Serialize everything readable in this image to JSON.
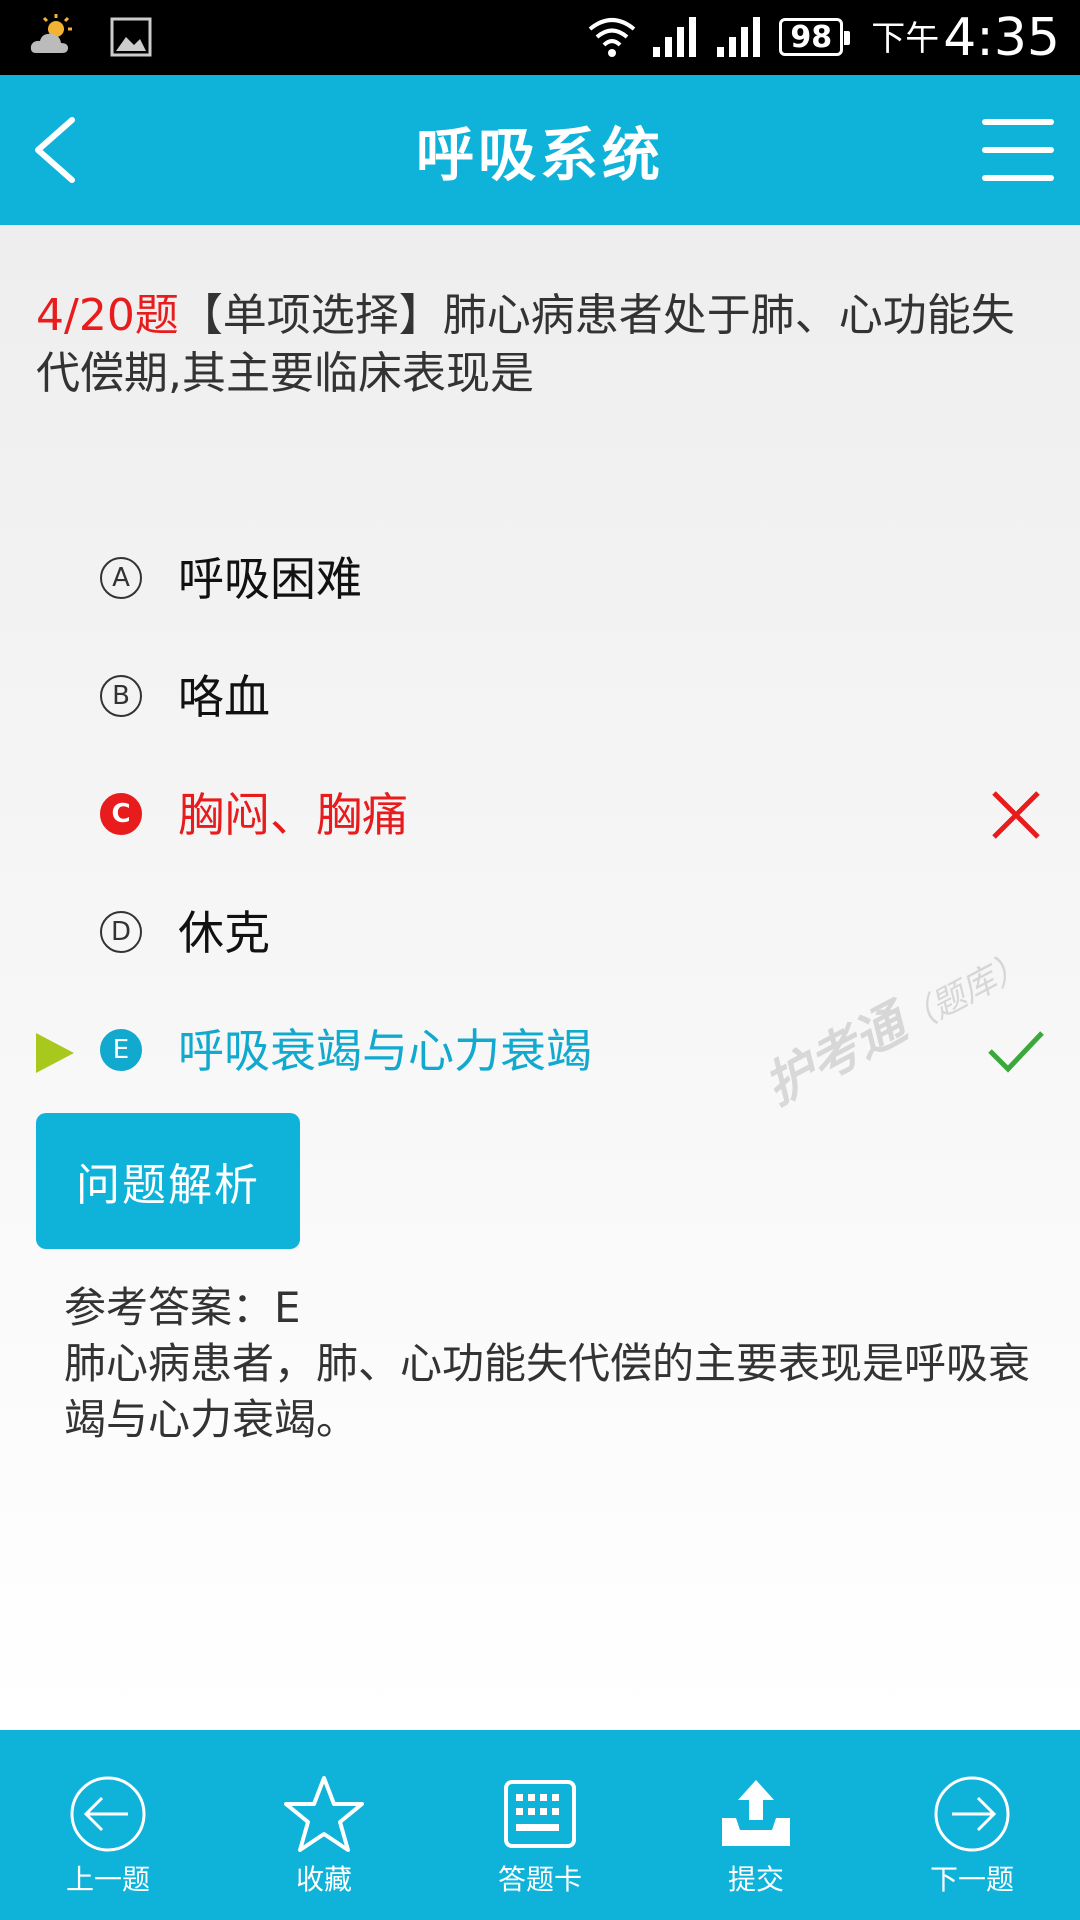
{
  "status_bar": {
    "battery": "98",
    "ampm": "下午",
    "time": "4:35"
  },
  "app_bar": {
    "title": "呼吸系统"
  },
  "question": {
    "number": "4/20题",
    "text": "【单项选择】肺心病患者处于肺、心功能失代偿期,其主要临床表现是"
  },
  "options": [
    {
      "letter": "A",
      "text": "呼吸困难"
    },
    {
      "letter": "B",
      "text": "咯血"
    },
    {
      "letter": "C",
      "text": "胸闷、胸痛"
    },
    {
      "letter": "D",
      "text": "休克"
    },
    {
      "letter": "E",
      "text": "呼吸衰竭与心力衰竭"
    }
  ],
  "watermark": {
    "main": "护考通",
    "sub": "（题库）"
  },
  "analysis": {
    "button_label": "问题解析",
    "reference_answer": "参考答案：E",
    "explanation": "肺心病患者，肺、心功能失代偿的主要表现是呼吸衰竭与心力衰竭。"
  },
  "bottom_nav": {
    "prev": "上一题",
    "favorite": "收藏",
    "answer_card": "答题卡",
    "submit": "提交",
    "next": "下一题"
  },
  "colors": {
    "accent": "#0fb3d9",
    "wrong": "#e81c1c",
    "correct_check": "#3aa83a",
    "play": "#a8c81e"
  }
}
